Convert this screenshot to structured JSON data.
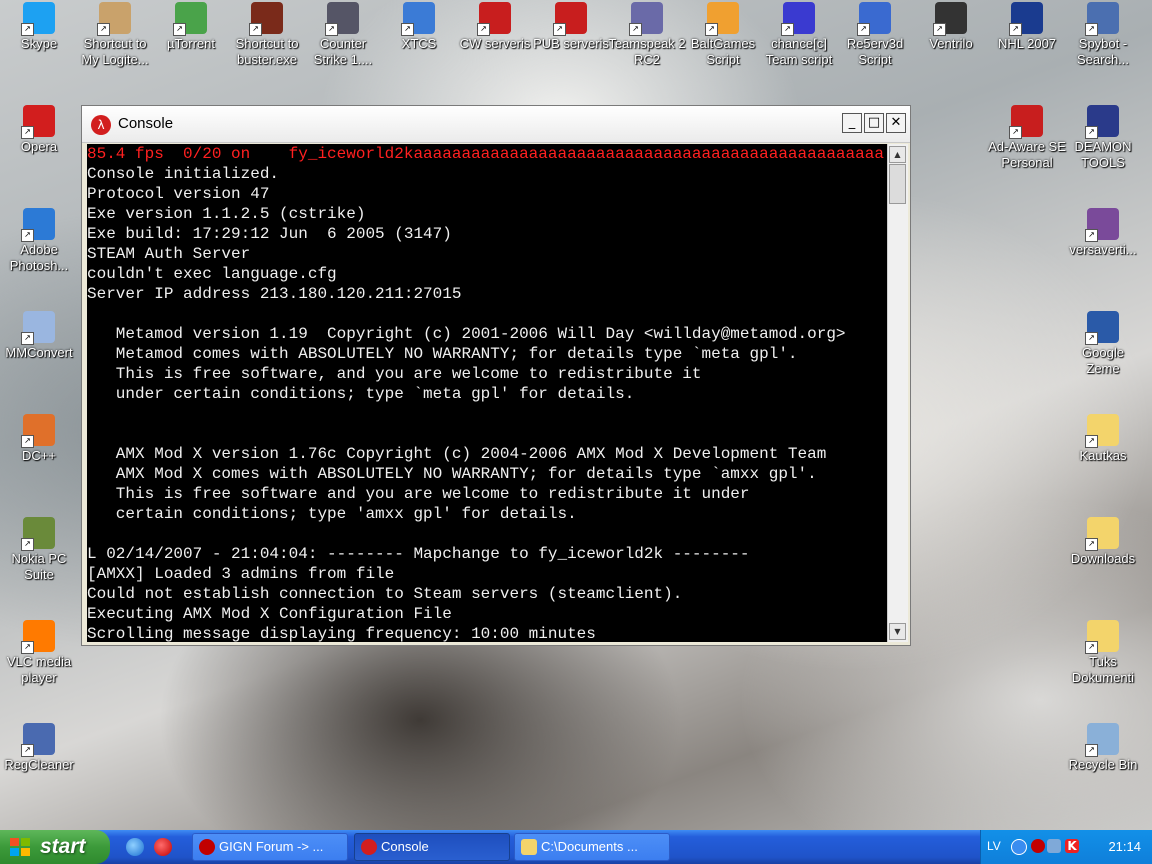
{
  "desktop": {
    "icons": [
      {
        "label": "Skype",
        "icon": "skype-icon"
      },
      {
        "label": "Shortcut to My Logite...",
        "icon": "logitech-shortcut-icon"
      },
      {
        "label": "µTorrent",
        "icon": "utorrent-icon"
      },
      {
        "label": "Shortcut to buster.exe",
        "icon": "buster-shortcut-icon"
      },
      {
        "label": "Counter Strike 1....",
        "icon": "counter-strike-icon"
      },
      {
        "label": "XTCS",
        "icon": "xtcs-icon"
      },
      {
        "label": "CW serveris",
        "icon": "cw-server-icon"
      },
      {
        "label": "PUB serveris",
        "icon": "pub-server-icon"
      },
      {
        "label": "Teamspeak 2 RC2",
        "icon": "teamspeak-icon"
      },
      {
        "label": "BaltGames Script",
        "icon": "baltgames-script-icon"
      },
      {
        "label": "chance[c] Team script",
        "icon": "team-script-icon"
      },
      {
        "label": "Re5erv3d Script",
        "icon": "reserved-script-icon"
      },
      {
        "label": "Ventrilo",
        "icon": "ventrilo-icon"
      },
      {
        "label": "NHL 2007",
        "icon": "nhl-2007-icon"
      },
      {
        "label": "Spybot - Search...",
        "icon": "spybot-icon"
      },
      {
        "label": "Opera",
        "icon": "opera-icon"
      },
      {
        "label": "Adobe Photosh...",
        "icon": "photoshop-icon"
      },
      {
        "label": "MMConvert",
        "icon": "mmconvert-icon"
      },
      {
        "label": "DC++",
        "icon": "dcpp-icon"
      },
      {
        "label": "Nokia PC Suite",
        "icon": "nokia-pc-suite-icon"
      },
      {
        "label": "VLC media player",
        "icon": "vlc-icon"
      },
      {
        "label": "RegCleaner",
        "icon": "regcleaner-icon"
      },
      {
        "label": "Ad-Aware SE Personal",
        "icon": "ad-aware-icon"
      },
      {
        "label": "DEAMON TOOLS",
        "icon": "daemon-tools-icon"
      },
      {
        "label": "versaverti...",
        "icon": "versaverti-icon"
      },
      {
        "label": "Google Zeme",
        "icon": "google-earth-icon"
      },
      {
        "label": "Kautkas",
        "icon": "folder-icon"
      },
      {
        "label": "Downloads",
        "icon": "folder-icon"
      },
      {
        "label": "Tuks Dokumenti",
        "icon": "folder-icon"
      },
      {
        "label": "Recycle Bin",
        "icon": "recycle-bin-icon"
      }
    ]
  },
  "window": {
    "title": "Console",
    "icon": "half-life-icon",
    "buttons": {
      "minimize": "_",
      "maximize": "□",
      "close": "✕"
    },
    "header_line": "85.4 fps  0/20 on    fy_iceworld2kaaaaaaaaaaaaaaaaaaaaaaaaaaaaaaaaaaaaaaaaaaaaaaaaa",
    "lines": [
      "Console initialized.",
      "Protocol version 47",
      "Exe version 1.1.2.5 (cstrike)",
      "Exe build: 17:29:12 Jun  6 2005 (3147)",
      "STEAM Auth Server",
      "couldn't exec language.cfg",
      "Server IP address 213.180.120.211:27015",
      "",
      "   Metamod version 1.19  Copyright (c) 2001-2006 Will Day <willday@metamod.org>",
      "   Metamod comes with ABSOLUTELY NO WARRANTY; for details type `meta gpl'.",
      "   This is free software, and you are welcome to redistribute it",
      "   under certain conditions; type `meta gpl' for details.",
      "",
      "",
      "   AMX Mod X version 1.76c Copyright (c) 2004-2006 AMX Mod X Development Team",
      "   AMX Mod X comes with ABSOLUTELY NO WARRANTY; for details type `amxx gpl'.",
      "   This is free software and you are welcome to redistribute it under",
      "   certain conditions; type 'amxx gpl' for details.",
      "",
      "L 02/14/2007 - 21:04:04: -------- Mapchange to fy_iceworld2k --------",
      "[AMXX] Loaded 3 admins from file",
      "Could not establish connection to Steam servers (steamclient).",
      "Executing AMX Mod X Configuration File",
      "Scrolling message displaying frequency: 10:00 minutes"
    ]
  },
  "taskbar": {
    "start_label": "start",
    "tasks": [
      {
        "label": "GIGN Forum -> ...",
        "icon": "opera-icon"
      },
      {
        "label": "Console",
        "icon": "half-life-icon"
      },
      {
        "label": "C:\\Documents ...",
        "icon": "folder-icon"
      }
    ],
    "tray": {
      "language": "LV",
      "clock": "21:14"
    }
  },
  "colors": {
    "console_header": "#ff2020",
    "console_text": "#f0f0f0",
    "taskbar": "#245edb",
    "start": "#3c9a3a"
  }
}
